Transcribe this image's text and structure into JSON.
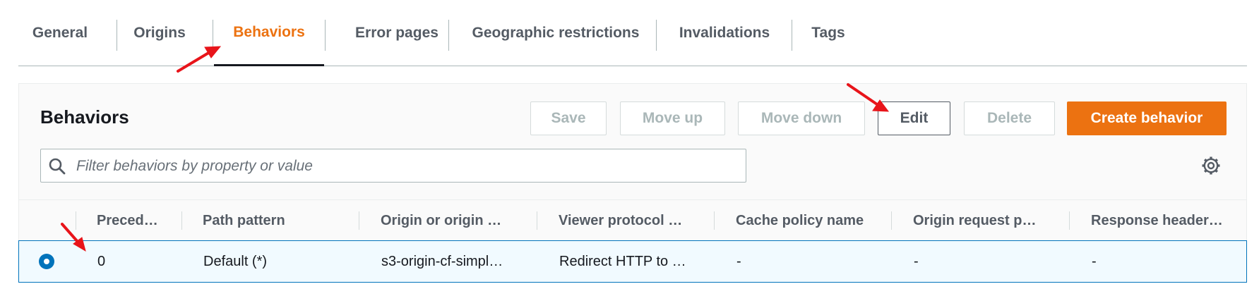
{
  "tabs": [
    {
      "label": "General",
      "active": false
    },
    {
      "label": "Origins",
      "active": false
    },
    {
      "label": "Behaviors",
      "active": true
    },
    {
      "label": "Error pages",
      "active": false
    },
    {
      "label": "Geographic restrictions",
      "active": false
    },
    {
      "label": "Invalidations",
      "active": false
    },
    {
      "label": "Tags",
      "active": false
    }
  ],
  "panel": {
    "title": "Behaviors",
    "buttons": {
      "save": "Save",
      "move_up": "Move up",
      "move_down": "Move down",
      "edit": "Edit",
      "delete": "Delete",
      "create": "Create behavior"
    },
    "search_placeholder": "Filter behaviors by property or value"
  },
  "table": {
    "columns": [
      "Preced…",
      "Path pattern",
      "Origin or origin …",
      "Viewer protocol …",
      "Cache policy name",
      "Origin request p…",
      "Response header…"
    ],
    "rows": [
      {
        "selected": true,
        "cells": [
          "0",
          "Default (*)",
          "s3-origin-cf-simpl…",
          "Redirect HTTP to …",
          "-",
          "-",
          "-"
        ]
      }
    ]
  },
  "icons": {
    "search": "search-icon",
    "settings": "gear-icon",
    "selected": "radio-selected-icon"
  },
  "colors": {
    "accent": "#ec7211",
    "selection_border": "#0073bb",
    "selection_bg": "#f1faff",
    "annotation_arrow": "#e8141a"
  }
}
